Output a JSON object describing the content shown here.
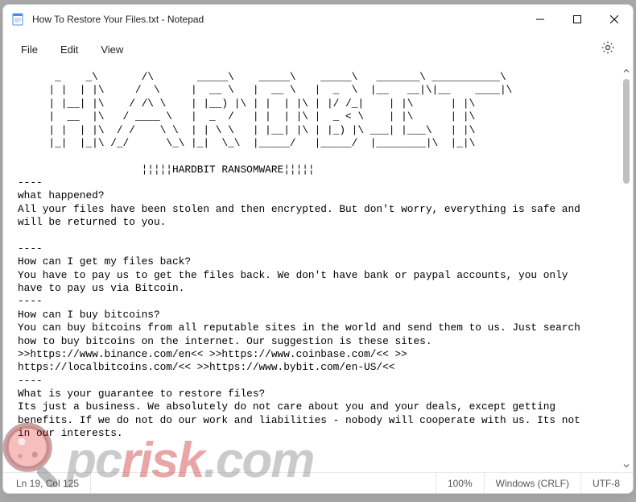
{
  "window": {
    "title": "How To Restore Your Files.txt - Notepad"
  },
  "menu": {
    "file": "File",
    "edit": "Edit",
    "view": "View"
  },
  "body_text": "      _    _\\       /\\       _____\\    _____\\    _____\\   _______\\ ___________\\\n     | |  | |\\     /  \\     |  __ \\   |  __ \\   |  _  \\  |__   __|\\|__    ____|\\\n     | |__| |\\    / /\\ \\    | |__) |\\ | |  | |\\ | |/ /_|    | |\\      | |\\\n     |  __  |\\   / ____ \\   |  _  /   | |  | |\\ |  _ < \\    | |\\      | |\\\n     | |  | |\\  / /    \\ \\  | | \\ \\   | |__| |\\ | |_) |\\ ___| |___\\   | |\\\n     |_|  |_|\\ /_/      \\_\\ |_|  \\_\\  |_____/   |_____/  |________|\\  |_|\\\n\n                    ¦¦¦¦¦HARDBIT RANSOMWARE¦¦¦¦¦\n----\nwhat happened?\nAll your files have been stolen and then encrypted. But don't worry, everything is safe and\nwill be returned to you.\n\n----\nHow can I get my files back?\nYou have to pay us to get the files back. We don't have bank or paypal accounts, you only\nhave to pay us via Bitcoin.\n----\nHow can I buy bitcoins?\nYou can buy bitcoins from all reputable sites in the world and send them to us. Just search\nhow to buy bitcoins on the internet. Our suggestion is these sites.\n>>https://www.binance.com/en<< >>https://www.coinbase.com/<< >>\nhttps://localbitcoins.com/<< >>https://www.bybit.com/en-US/<<\n----\nWhat is your guarantee to restore files?\nIts just a business. We absolutely do not care about you and your deals, except getting\nbenefits. If we do not do our work and liabilities - nobody will cooperate with us. Its not\nin our interests.",
  "status": {
    "position": "Ln 19, Col 125",
    "zoom": "100%",
    "line_ending": "Windows (CRLF)",
    "encoding": "UTF-8"
  },
  "watermark": {
    "part1": "pc",
    "part2": "risk",
    "part3": ".com"
  }
}
